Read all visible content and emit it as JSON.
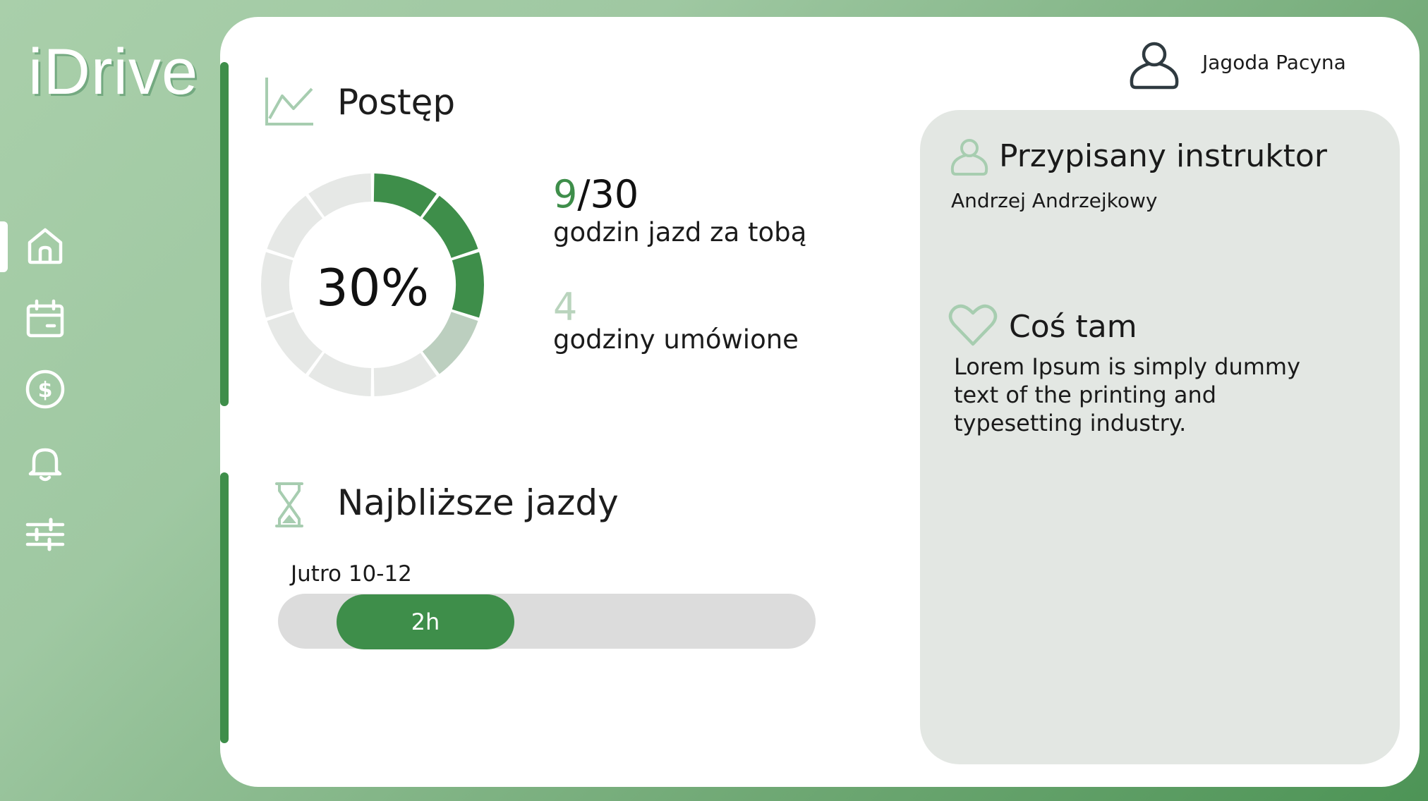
{
  "app": {
    "logo": "iDrive"
  },
  "nav": [
    {
      "id": "home",
      "icon": "home-icon",
      "active": true
    },
    {
      "id": "calendar",
      "icon": "calendar-icon",
      "active": false
    },
    {
      "id": "payments",
      "icon": "dollar-icon",
      "active": false
    },
    {
      "id": "notifications",
      "icon": "bell-icon",
      "active": false
    },
    {
      "id": "settings",
      "icon": "sliders-icon",
      "active": false
    }
  ],
  "user": {
    "name": "Jagoda Pacyna",
    "icon": "user-icon"
  },
  "progress": {
    "title": "Postęp",
    "icon": "chart-line-icon",
    "percent_label": "30%",
    "done_hours": "9",
    "total_hours": "/30",
    "done_caption": "godzin jazd za tobą",
    "scheduled_hours": "4",
    "scheduled_caption": "godziny umówione",
    "donut": {
      "segments": 10,
      "completed_segments": 3,
      "scheduled_segments": 1
    }
  },
  "upcoming": {
    "title": "Najbliższe jazdy",
    "icon": "hourglass-icon",
    "items": [
      {
        "when": "Jutro 10-12",
        "duration": "2h"
      }
    ]
  },
  "instructor": {
    "title": "Przypisany instruktor",
    "icon": "user-outline-icon",
    "name": "Andrzej Andrzejkowy"
  },
  "misc": {
    "title": "Coś tam",
    "icon": "heart-icon",
    "body": "Lorem Ipsum is simply dummy text of the printing and typesetting industry."
  },
  "colors": {
    "accent": "#3e8e4a",
    "scheduled": "#b9d4bd",
    "track": "#dcdcdc",
    "panel": "#e3e7e3"
  }
}
